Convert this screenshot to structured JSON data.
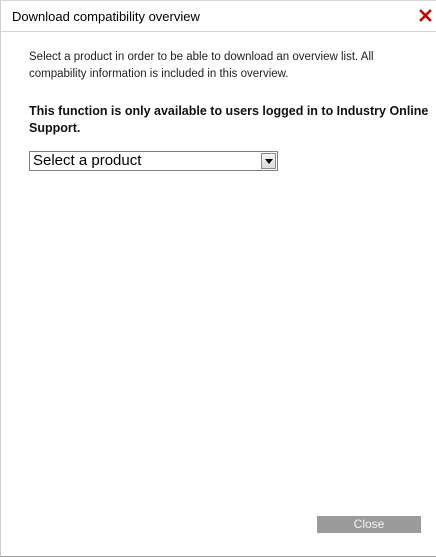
{
  "dialog": {
    "title": "Download compatibility overview",
    "close_icon": "close-x-icon",
    "close_icon_color": "#c00000"
  },
  "content": {
    "intro": "Select a product in order to be able to download an overview list. All compability information is included in this overview.",
    "notice": "This function is only available to users logged in to Industry Online Support."
  },
  "product_select": {
    "selected": "Select a product",
    "arrow_icon": "chevron-down-icon"
  },
  "footer": {
    "close_label": "Close",
    "close_button_color": "#9b9b9b"
  }
}
